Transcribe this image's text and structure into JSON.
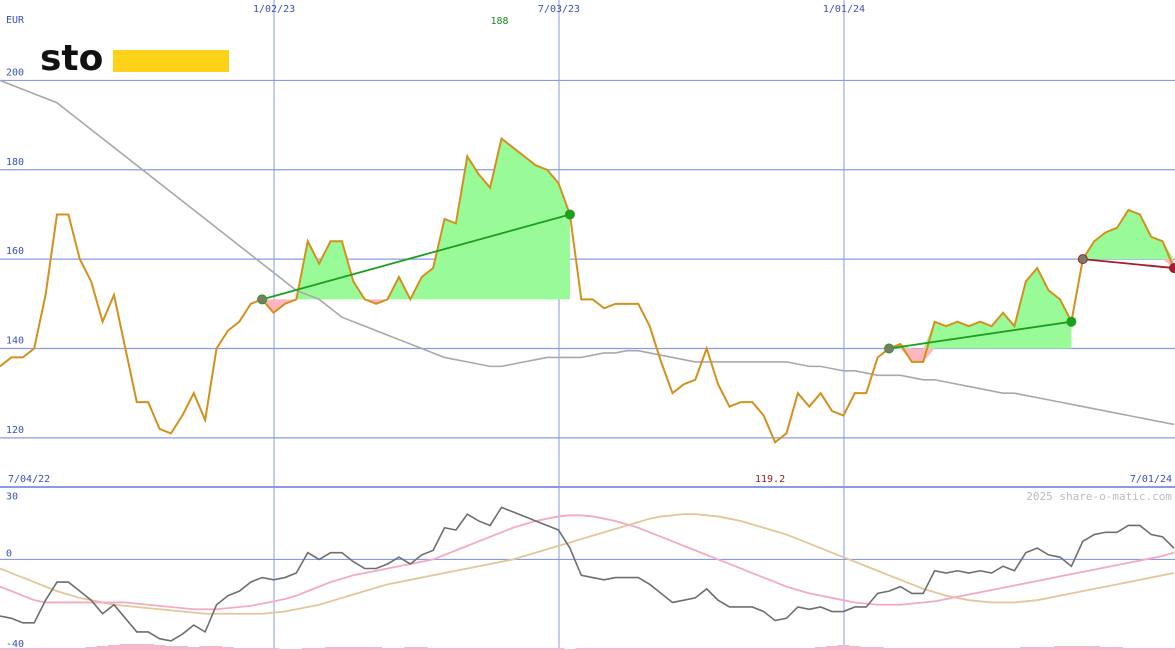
{
  "brand": {
    "name": "sto",
    "accent": "#FFD21A"
  },
  "watermark": "2025 share-o-matic.com",
  "colors": {
    "price": "#D4901C",
    "ma_long": "#A8A8A8",
    "grid": "#8A9BE6",
    "gain_fill": "#98FB98",
    "loss_fill": "#FFB6C1",
    "gain_line": "#1E9E1E",
    "loss_line": "#A01E2E",
    "osc": "#6E6E6E",
    "osc_fast": "#F4AAC4",
    "osc_slow": "#E2C79A",
    "volume": "#F8B8CC"
  },
  "chart_data": [
    {
      "type": "line",
      "panel": "price",
      "ylabel": "EUR",
      "ylim": [
        109,
        218
      ],
      "yticks": [
        120,
        140,
        160,
        180,
        200
      ],
      "grid": true,
      "x_axis": {
        "start_label": "7/04/22",
        "end_label": "7/01/24",
        "top_labels": [
          "1/02/23",
          "7/03/23",
          "1/01/24"
        ]
      },
      "annotations": {
        "high": "188",
        "low": "119.2"
      },
      "series": [
        {
          "role": "price",
          "values": [
            136,
            138,
            138,
            140,
            152,
            170,
            170,
            160,
            155,
            146,
            152,
            140,
            128,
            128,
            122,
            121,
            125,
            130,
            124,
            140,
            144,
            146,
            150,
            151,
            148,
            150,
            151,
            164,
            159,
            164,
            164,
            155,
            151,
            150,
            151,
            156,
            151,
            156,
            158,
            169,
            168,
            183,
            179,
            176,
            187,
            185,
            183,
            181,
            180,
            177,
            170,
            151,
            151,
            149,
            150,
            150,
            150,
            145,
            137,
            130,
            132,
            133,
            140,
            132,
            127,
            128,
            128,
            125,
            119,
            121,
            130,
            127,
            130,
            126,
            125,
            130,
            130,
            138,
            140,
            141,
            137,
            137,
            146,
            145,
            146,
            145,
            146,
            145,
            148,
            145,
            155,
            158,
            153,
            151,
            146,
            160,
            164,
            166,
            167,
            171,
            170,
            165,
            164,
            158
          ]
        },
        {
          "role": "moving-average",
          "values": [
            200,
            199,
            198,
            197,
            196,
            195,
            193,
            191,
            189,
            187,
            185,
            183,
            181,
            179,
            177,
            175,
            173,
            171,
            169,
            167,
            165,
            163,
            161,
            159,
            157,
            155,
            153,
            152,
            151,
            149,
            147,
            146,
            145,
            144,
            143,
            142,
            141,
            140,
            139,
            138,
            137.5,
            137,
            136.5,
            136,
            136,
            136.5,
            137,
            137.5,
            138,
            138,
            138,
            138,
            138.5,
            139,
            139,
            139.5,
            139.5,
            139,
            138.5,
            138,
            137.5,
            137,
            137,
            137,
            137,
            137,
            137,
            137,
            137,
            137,
            136.5,
            136,
            136,
            135.5,
            135,
            135,
            134.5,
            134,
            134,
            134,
            133.5,
            133,
            133,
            132.5,
            132,
            131.5,
            131,
            130.5,
            130,
            130,
            129.5,
            129,
            128.5,
            128,
            127.5,
            127,
            126.5,
            126,
            125.5,
            125,
            124.5,
            124,
            123.5,
            123
          ]
        }
      ],
      "trades": [
        {
          "entry_index": 23,
          "exit_index": 50,
          "entry": 151,
          "exit": 170,
          "result": "gain"
        },
        {
          "entry_index": 78,
          "exit_index": 94,
          "entry": 140,
          "exit": 146,
          "result": "gain"
        },
        {
          "entry_index": 95,
          "exit_index": 103,
          "entry": 160,
          "exit": 158,
          "result": "loss"
        }
      ]
    },
    {
      "type": "line",
      "panel": "oscillator",
      "ylim": [
        -40,
        32
      ],
      "yticks": [
        30,
        0,
        -40
      ],
      "grid": true,
      "series": [
        {
          "role": "oscillator",
          "values": [
            -25,
            -26,
            -28,
            -28,
            -18,
            -10,
            -10,
            -14,
            -18,
            -24,
            -20,
            -26,
            -32,
            -32,
            -35,
            -36,
            -33,
            -29,
            -32,
            -20,
            -16,
            -14,
            -10,
            -8,
            -9,
            -8,
            -6,
            3,
            0,
            3,
            3,
            -1,
            -4,
            -4,
            -2,
            1,
            -2,
            2,
            4,
            14,
            13,
            20,
            17,
            15,
            23,
            21,
            19,
            17,
            15,
            13,
            5,
            -7,
            -8,
            -9,
            -8,
            -8,
            -8,
            -11,
            -15,
            -19,
            -18,
            -17,
            -13,
            -18,
            -21,
            -21,
            -21,
            -23,
            -27,
            -26,
            -21,
            -22,
            -21,
            -23,
            -23,
            -21,
            -21,
            -15,
            -14,
            -12,
            -15,
            -15,
            -5,
            -6,
            -5,
            -6,
            -5,
            -6,
            -3,
            -5,
            3,
            5,
            2,
            1,
            -3,
            8,
            11,
            12,
            12,
            15,
            15,
            11,
            10,
            5
          ]
        },
        {
          "role": "fast-average",
          "values": [
            -12,
            -14,
            -16,
            -18,
            -19,
            -19,
            -19,
            -19,
            -19,
            -19,
            -19,
            -19,
            -19.5,
            -20,
            -20.5,
            -21,
            -21.5,
            -22,
            -22,
            -22,
            -21.5,
            -21,
            -20.5,
            -19.5,
            -18.5,
            -17.5,
            -16,
            -14,
            -12,
            -10,
            -8.5,
            -7,
            -6,
            -5,
            -4,
            -3,
            -2,
            -1,
            0,
            2,
            4,
            6,
            8,
            10,
            12,
            14,
            15.5,
            17,
            18,
            19,
            19.5,
            19.5,
            19,
            18,
            17,
            15.5,
            14,
            12,
            10,
            8,
            6,
            4,
            2,
            0,
            -2,
            -4,
            -6,
            -8,
            -10,
            -12,
            -13.5,
            -15,
            -16,
            -17,
            -18,
            -19,
            -19.5,
            -20,
            -20,
            -20,
            -19.5,
            -19,
            -18.5,
            -17.5,
            -16.5,
            -15.5,
            -14.5,
            -13.5,
            -12.5,
            -11.5,
            -10.5,
            -9.5,
            -8.5,
            -7.5,
            -6.5,
            -5.5,
            -4.5,
            -3.5,
            -2.5,
            -1.5,
            -0.5,
            0.5,
            1.5,
            3
          ]
        },
        {
          "role": "slow-average",
          "values": [
            -4,
            -6,
            -8,
            -10,
            -12,
            -14,
            -15.5,
            -17,
            -18,
            -19,
            -20,
            -20.5,
            -21,
            -21.5,
            -22,
            -22.5,
            -23,
            -23.5,
            -24,
            -24,
            -24,
            -24,
            -24,
            -24,
            -23.5,
            -23,
            -22,
            -21,
            -20,
            -18.5,
            -17,
            -15.5,
            -14,
            -12.5,
            -11,
            -10,
            -9,
            -8,
            -7,
            -6,
            -5,
            -4,
            -3,
            -2,
            -1,
            0,
            1.5,
            3,
            4.5,
            6,
            7.5,
            9,
            10.5,
            12,
            13.5,
            15,
            16.5,
            18,
            19,
            19.5,
            20,
            20,
            19.5,
            19,
            18,
            17,
            15.5,
            14,
            12.5,
            11,
            9,
            7,
            5,
            3,
            1,
            -1,
            -3,
            -5,
            -7,
            -9,
            -11,
            -13,
            -14.5,
            -16,
            -17,
            -18,
            -18.5,
            -19,
            -19,
            -19,
            -18.5,
            -18,
            -17,
            -16,
            -15,
            -14,
            -13,
            -12,
            -11,
            -10,
            -9,
            -8,
            -7,
            -6
          ]
        },
        {
          "role": "volume",
          "values": [
            2,
            2,
            2,
            2,
            2,
            2,
            2,
            2,
            3,
            4,
            5,
            6,
            6,
            6,
            5,
            4,
            4,
            3,
            4,
            4,
            3,
            2,
            2,
            2,
            2,
            1,
            1,
            2,
            2,
            3,
            3,
            3,
            3,
            3,
            2,
            2,
            3,
            3,
            2,
            2,
            2,
            2,
            2,
            2,
            2,
            2,
            2,
            2,
            2,
            2,
            1,
            2,
            2,
            2,
            2,
            2,
            2,
            2,
            2,
            2,
            2,
            2,
            2,
            2,
            2,
            2,
            2,
            2,
            2,
            2,
            2,
            2,
            3,
            4,
            5,
            4,
            3,
            3,
            2,
            2,
            2,
            2,
            2,
            2,
            2,
            2,
            2,
            2,
            2,
            2,
            3,
            3,
            3,
            4,
            4,
            4,
            4,
            3,
            3,
            2,
            2,
            2,
            2,
            2
          ]
        }
      ]
    }
  ]
}
